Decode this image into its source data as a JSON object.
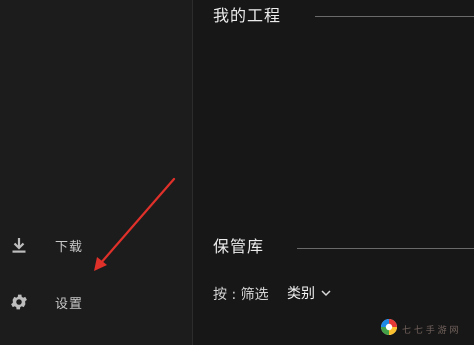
{
  "sidebar": {
    "items": [
      {
        "label": "下载",
        "icon": "download-icon"
      },
      {
        "label": "设置",
        "icon": "gear-icon"
      }
    ]
  },
  "main": {
    "projects_title": "我的工程",
    "vault_title": "保管库",
    "filter": {
      "label": "按 : 筛选",
      "selected": "类别",
      "icon": "chevron-down-icon"
    }
  },
  "annotation": {
    "color": "#e0302a",
    "icon": "arrow-annotation"
  },
  "watermark": {
    "text": "七 七 手 游 网",
    "icon": "watermark-logo"
  },
  "colors": {
    "background": "#171717",
    "sidebar": "#1c1c1c",
    "text": "#c8c8c8",
    "rule": "#6a6a6a"
  }
}
